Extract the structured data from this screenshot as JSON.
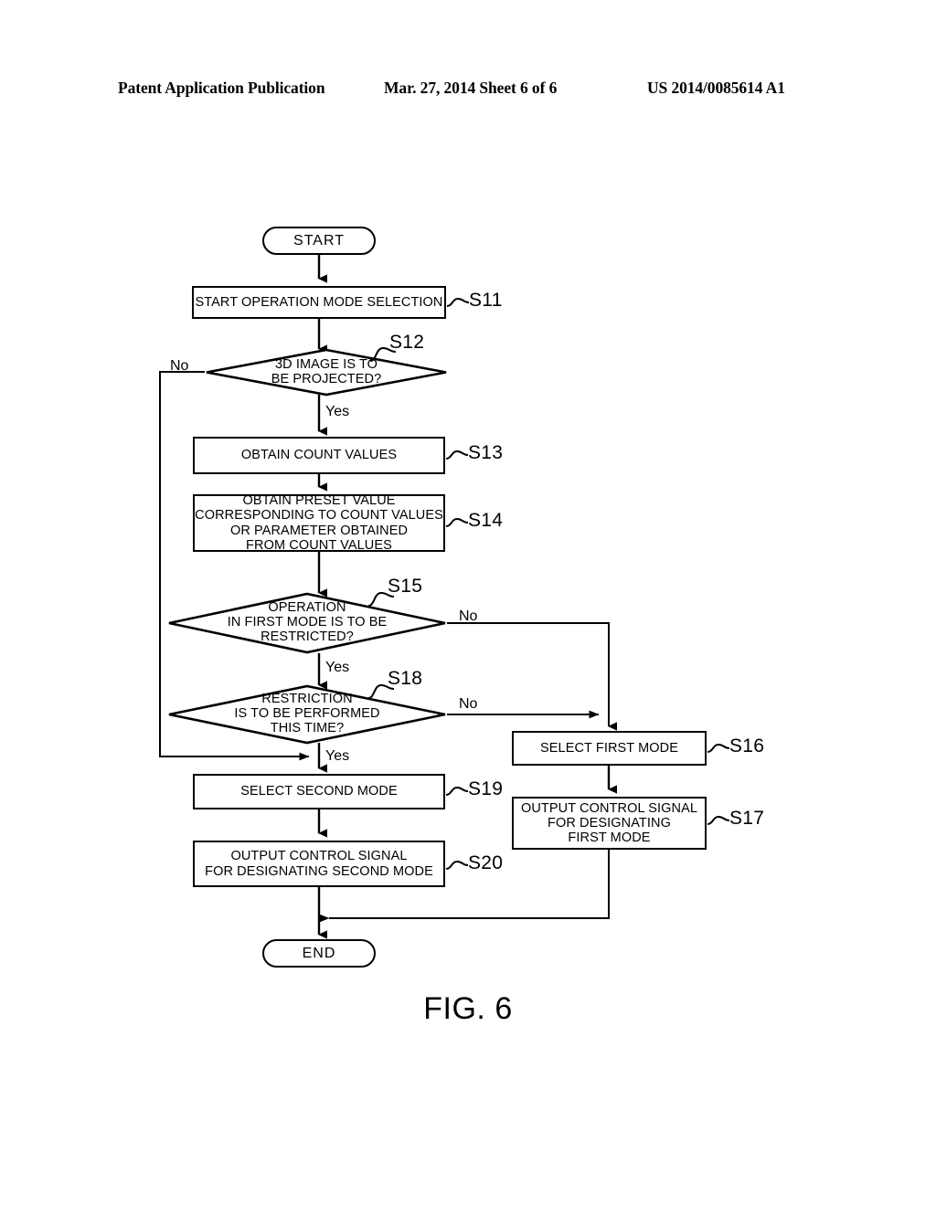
{
  "header": {
    "publication": "Patent Application Publication",
    "date_sheet": "Mar. 27, 2014  Sheet 6 of 6",
    "patent_number": "US 2014/0085614 A1"
  },
  "figure": {
    "caption": "FIG. 6"
  },
  "flowchart": {
    "start": {
      "label": "START"
    },
    "end": {
      "label": "END"
    },
    "s11": {
      "text": "START OPERATION MODE SELECTION",
      "step": "S11"
    },
    "s12": {
      "text": "3D IMAGE IS TO\nBE PROJECTED?",
      "step": "S12",
      "no": "No",
      "yes": "Yes"
    },
    "s13": {
      "text": "OBTAIN COUNT VALUES",
      "step": "S13"
    },
    "s14": {
      "text": "OBTAIN PRESET VALUE\nCORRESPONDING TO COUNT VALUES\nOR PARAMETER OBTAINED\nFROM COUNT VALUES",
      "step": "S14"
    },
    "s15": {
      "text": "OPERATION\nIN FIRST MODE IS TO BE\nRESTRICTED?",
      "step": "S15",
      "no": "No",
      "yes": "Yes"
    },
    "s18": {
      "text": "RESTRICTION\nIS TO BE PERFORMED\nTHIS TIME?",
      "step": "S18",
      "no": "No",
      "yes": "Yes"
    },
    "s16": {
      "text": "SELECT FIRST MODE",
      "step": "S16"
    },
    "s17": {
      "text": "OUTPUT CONTROL SIGNAL\nFOR DESIGNATING\nFIRST MODE",
      "step": "S17"
    },
    "s19": {
      "text": "SELECT SECOND MODE",
      "step": "S19"
    },
    "s20": {
      "text": "OUTPUT CONTROL SIGNAL\nFOR DESIGNATING SECOND MODE",
      "step": "S20"
    }
  },
  "colors": {
    "ink": "#000000",
    "paper": "#ffffff"
  }
}
